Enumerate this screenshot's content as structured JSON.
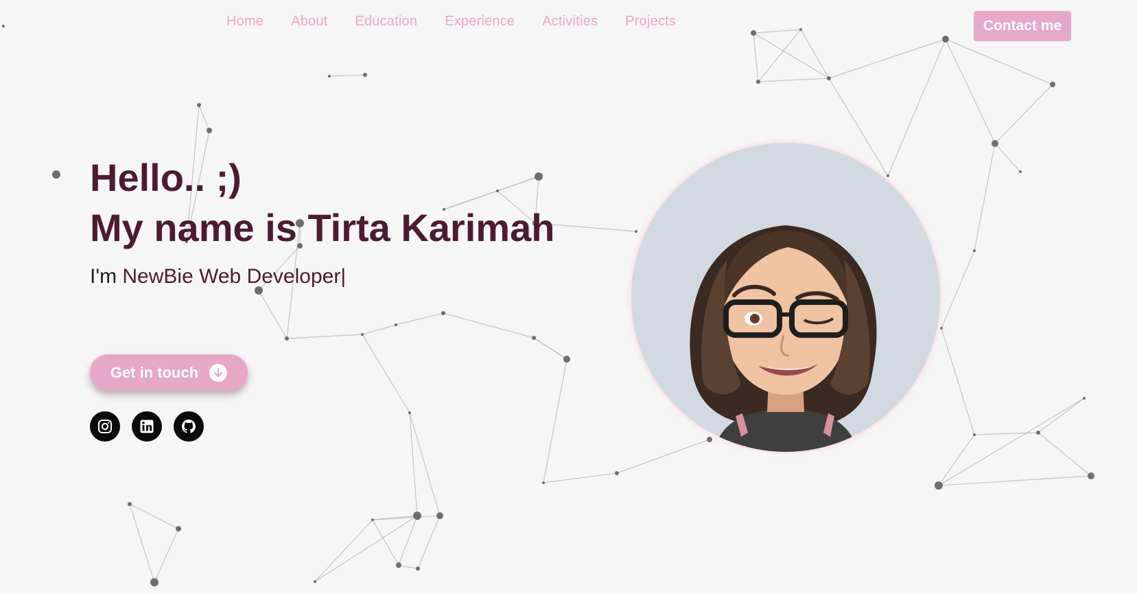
{
  "nav": {
    "items": [
      "Home",
      "About",
      "Education",
      "Experience",
      "Activities",
      "Projects"
    ],
    "contact_label": "Contact me"
  },
  "hero": {
    "greeting": "Hello.. ;)",
    "name_line": "My name is Tirta Karimah",
    "sub_prefix": "I'm ",
    "role": "NewBie Web Developer",
    "cursor": "|",
    "cta_label": "Get in touch"
  },
  "socials": [
    "instagram-icon",
    "linkedin-icon",
    "github-icon"
  ],
  "colors": {
    "accent": "#e6a9c9",
    "title": "#4d1b31",
    "background": "#f6f6f6"
  }
}
